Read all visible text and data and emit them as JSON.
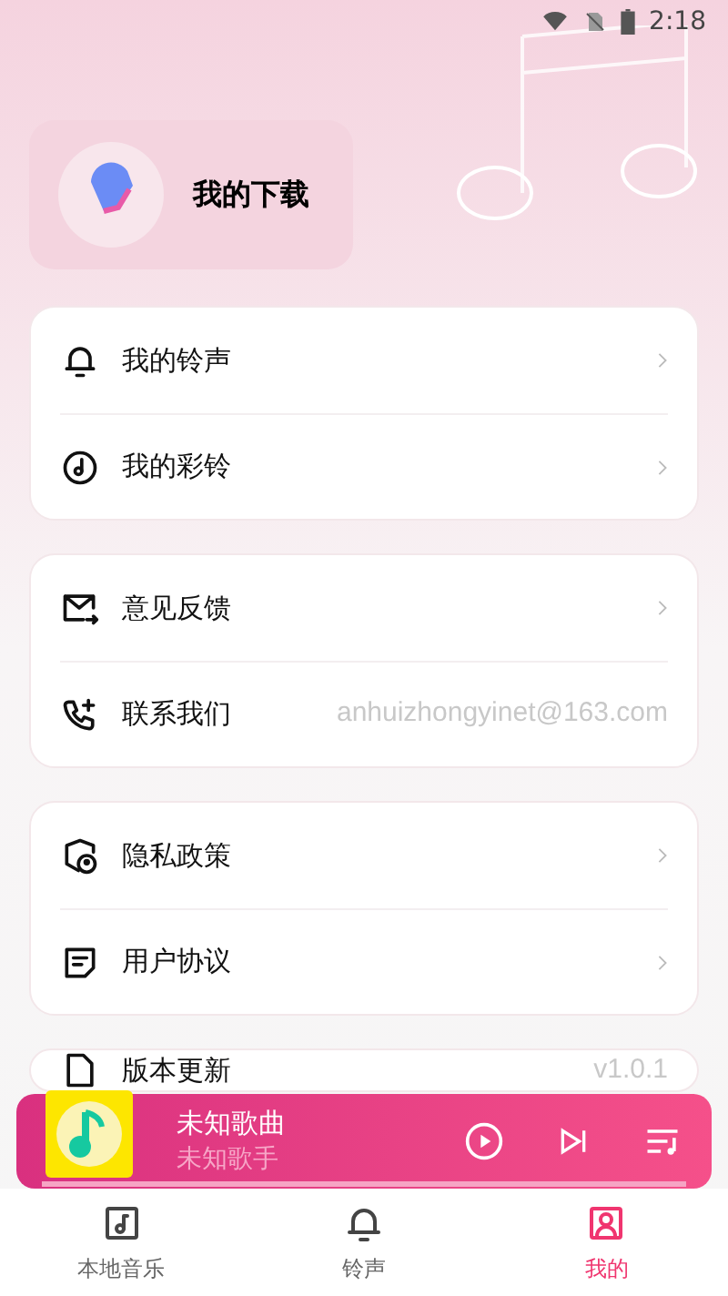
{
  "status_bar": {
    "time": "2:18"
  },
  "download": {
    "label": "我的下载"
  },
  "groups": [
    {
      "items": [
        {
          "label": "我的铃声"
        },
        {
          "label": "我的彩铃"
        }
      ]
    },
    {
      "items": [
        {
          "label": "意见反馈"
        },
        {
          "label": "联系我们",
          "value": "anhuizhongyinet@163.com"
        }
      ]
    },
    {
      "items": [
        {
          "label": "隐私政策"
        },
        {
          "label": "用户协议"
        }
      ]
    },
    {
      "items": [
        {
          "label": "版本更新",
          "value": "v1.0.1"
        }
      ]
    }
  ],
  "player": {
    "title": "未知歌曲",
    "artist": "未知歌手"
  },
  "nav": [
    {
      "label": "本地音乐",
      "selected": false
    },
    {
      "label": "铃声",
      "selected": false
    },
    {
      "label": "我的",
      "selected": true
    }
  ]
}
